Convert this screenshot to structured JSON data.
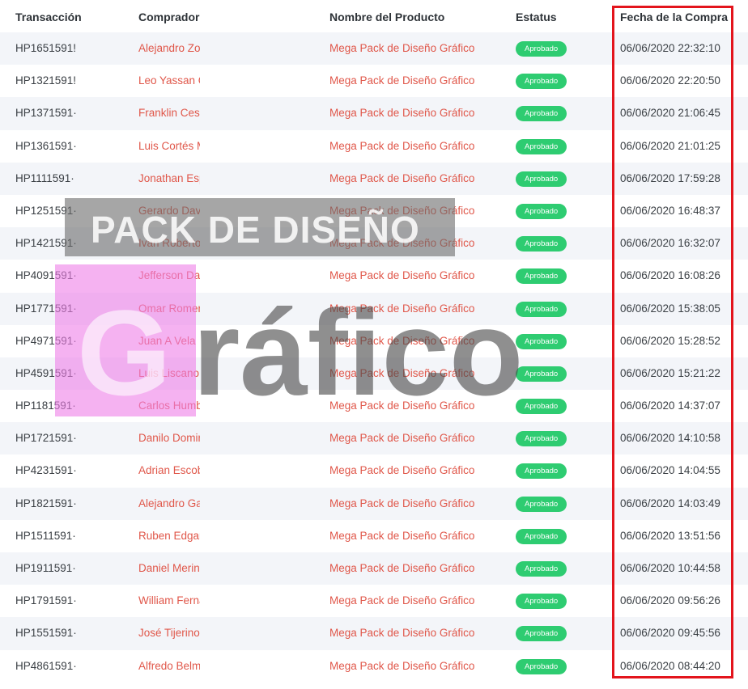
{
  "columns": {
    "transaction": "Transacción",
    "buyer": "Comprador",
    "product": "Nombre del Producto",
    "status": "Estatus",
    "date": "Fecha de la Compra"
  },
  "rows": [
    {
      "transaction": "HP1651591!",
      "buyer": "Alejandro Zoz",
      "product": "Mega Pack de Diseño Gráfico",
      "status": "Aprobado",
      "date": "06/06/2020 22:32:10"
    },
    {
      "transaction": "HP1321591!",
      "buyer": "Leo Yassan C",
      "product": "Mega Pack de Diseño Gráfico",
      "status": "Aprobado",
      "date": "06/06/2020 22:20:50"
    },
    {
      "transaction": "HP1371591·",
      "buyer": "Franklin Cesp",
      "product": "Mega Pack de Diseño Gráfico",
      "status": "Aprobado",
      "date": "06/06/2020 21:06:45"
    },
    {
      "transaction": "HP1361591·",
      "buyer": "Luis Cortés M",
      "product": "Mega Pack de Diseño Gráfico",
      "status": "Aprobado",
      "date": "06/06/2020 21:01:25"
    },
    {
      "transaction": "HP1111591·",
      "buyer": "Jonathan Esp",
      "product": "Mega Pack de Diseño Gráfico",
      "status": "Aprobado",
      "date": "06/06/2020 17:59:28"
    },
    {
      "transaction": "HP1251591·",
      "buyer": "Gerardo Davi",
      "product": "Mega Pack de Diseño Gráfico",
      "status": "Aprobado",
      "date": "06/06/2020 16:48:37"
    },
    {
      "transaction": "HP1421591·",
      "buyer": "Ivan Roberto",
      "product": "Mega Pack de Diseño Gráfico",
      "status": "Aprobado",
      "date": "06/06/2020 16:32:07"
    },
    {
      "transaction": "HP4091591·",
      "buyer": "Jefferson Dar",
      "product": "Mega Pack de Diseño Gráfico",
      "status": "Aprobado",
      "date": "06/06/2020 16:08:26"
    },
    {
      "transaction": "HP1771591·",
      "buyer": "Omar Romero",
      "product": "Mega Pack de Diseño Gráfico",
      "status": "Aprobado",
      "date": "06/06/2020 15:38:05"
    },
    {
      "transaction": "HP4971591·",
      "buyer": "Juan A Vela",
      "product": "Mega Pack de Diseño Gráfico",
      "status": "Aprobado",
      "date": "06/06/2020 15:28:52"
    },
    {
      "transaction": "HP4591591·",
      "buyer": "Luis Liscano",
      "product": "Mega Pack de Diseño Gráfico",
      "status": "Aprobado",
      "date": "06/06/2020 15:21:22"
    },
    {
      "transaction": "HP1181591·",
      "buyer": "Carlos Humbe",
      "product": "Mega Pack de Diseño Gráfico",
      "status": "Aprobado",
      "date": "06/06/2020 14:37:07"
    },
    {
      "transaction": "HP1721591·",
      "buyer": "Danilo Domin",
      "product": "Mega Pack de Diseño Gráfico",
      "status": "Aprobado",
      "date": "06/06/2020 14:10:58"
    },
    {
      "transaction": "HP4231591·",
      "buyer": "Adrian Escob",
      "product": "Mega Pack de Diseño Gráfico",
      "status": "Aprobado",
      "date": "06/06/2020 14:04:55"
    },
    {
      "transaction": "HP1821591·",
      "buyer": "Alejandro Gal",
      "product": "Mega Pack de Diseño Gráfico",
      "status": "Aprobado",
      "date": "06/06/2020 14:03:49"
    },
    {
      "transaction": "HP1511591·",
      "buyer": "Ruben Edgar",
      "product": "Mega Pack de Diseño Gráfico",
      "status": "Aprobado",
      "date": "06/06/2020 13:51:56"
    },
    {
      "transaction": "HP1911591·",
      "buyer": "Daniel Merinc",
      "product": "Mega Pack de Diseño Gráfico",
      "status": "Aprobado",
      "date": "06/06/2020 10:44:58"
    },
    {
      "transaction": "HP1791591·",
      "buyer": "William Ferna",
      "product": "Mega Pack de Diseño Gráfico",
      "status": "Aprobado",
      "date": "06/06/2020 09:56:26"
    },
    {
      "transaction": "HP1551591·",
      "buyer": "José Tijerino",
      "product": "Mega Pack de Diseño Gráfico",
      "status": "Aprobado",
      "date": "06/06/2020 09:45:56"
    },
    {
      "transaction": "HP4861591·",
      "buyer": "Alfredo Belm",
      "product": "Mega Pack de Diseño Gráfico",
      "status": "Aprobado",
      "date": "06/06/2020 08:44:20"
    }
  ],
  "watermark": {
    "line1": "PACK DE DISEÑO",
    "line2_initial": "G",
    "line2_rest": "ráfico"
  },
  "colors": {
    "status_badge": "#2ecc71",
    "link_text": "#e0574a",
    "highlight_border": "#e3141c",
    "watermark_band": "#6b6b6b",
    "watermark_pink": "#ee7ee8"
  }
}
